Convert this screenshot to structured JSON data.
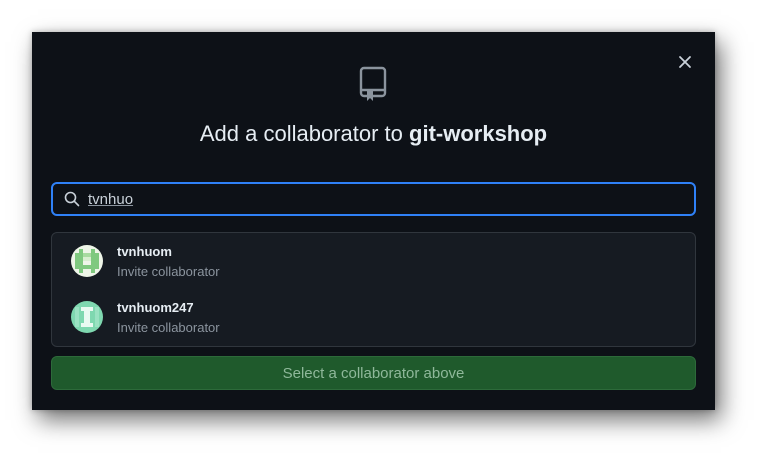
{
  "dialog": {
    "title_prefix": "Add a collaborator to",
    "repo_name": "git-workshop",
    "close_icon": "close-icon",
    "repo_icon": "repo-icon"
  },
  "search": {
    "value": "tvnhuo",
    "icon": "search-icon"
  },
  "results": [
    {
      "username": "tvnhuom",
      "action": "Invite collaborator",
      "avatar_color": "#7fc97f"
    },
    {
      "username": "tvnhuom247",
      "action": "Invite collaborator",
      "avatar_color": "#7fd8b0"
    }
  ],
  "submit": {
    "label": "Select a collaborator above"
  },
  "colors": {
    "background": "#0d1117",
    "focus_border": "#2f81f7",
    "button_bg": "#1f5a2c"
  }
}
